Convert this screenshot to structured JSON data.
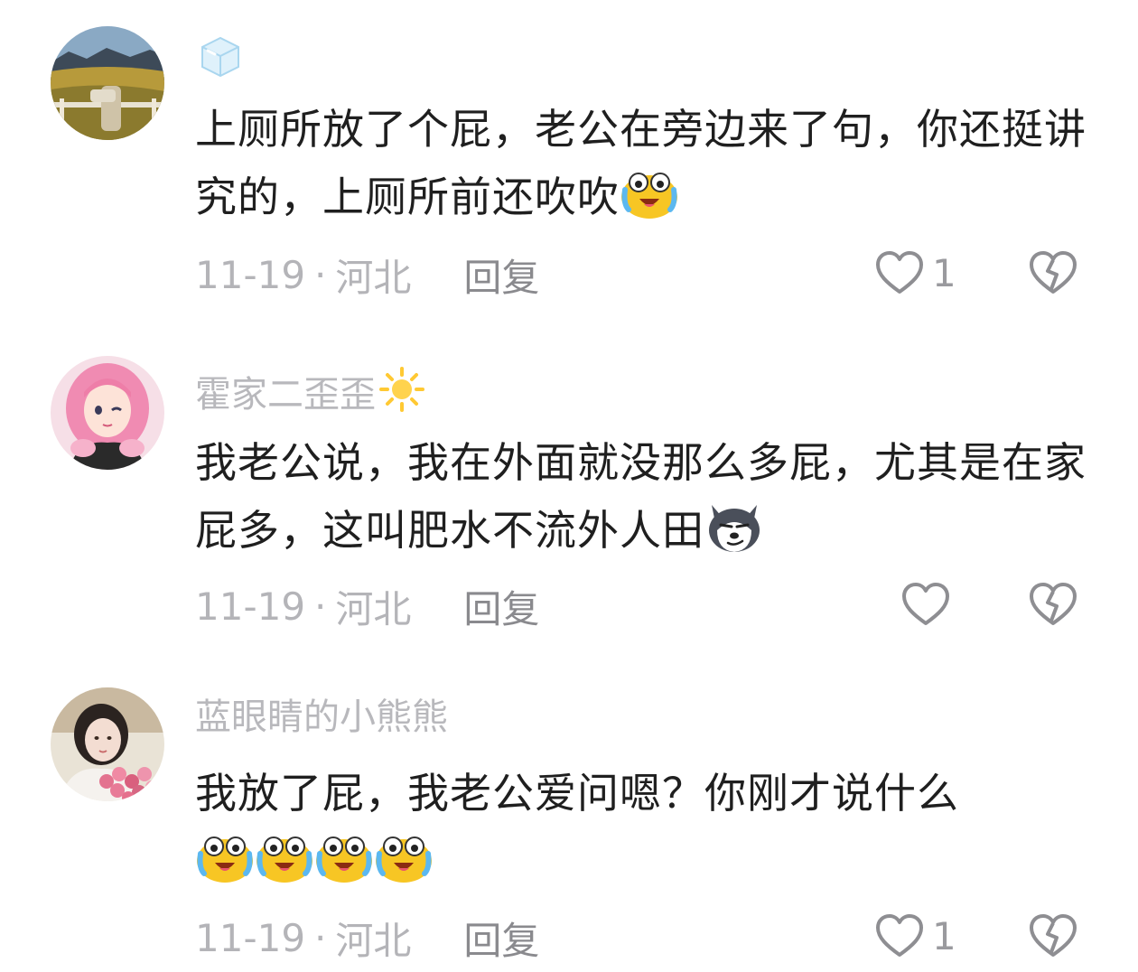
{
  "comments": [
    {
      "username": "",
      "username_icon": "ice-cube-icon",
      "text_parts": [
        "上厕所放了个屁，老公在旁边来了句，你还挺讲究的，上厕所前还吹吹"
      ],
      "trailing_emoji": [
        "cry-laugh-emoji"
      ],
      "date": "11-19",
      "separator": "·",
      "location": "河北",
      "reply_label": "回复",
      "like_count": "1"
    },
    {
      "username": "霍家二歪歪",
      "username_icon": "sun-icon",
      "text_parts": [
        "我老公说，我在外面就没那么多屁，尤其是在家屁多，这叫肥水不流外人田"
      ],
      "trailing_emoji": [
        "smirk-husky-emoji"
      ],
      "date": "11-19",
      "separator": "·",
      "location": "河北",
      "reply_label": "回复",
      "like_count": ""
    },
    {
      "username": "蓝眼睛的小熊熊",
      "username_icon": "",
      "text_parts": [
        "我放了屁，我老公爱问嗯？你刚才说什么"
      ],
      "trailing_emoji": [
        "cry-laugh-emoji",
        "cry-laugh-emoji",
        "cry-laugh-emoji",
        "cry-laugh-emoji"
      ],
      "date": "11-19",
      "separator": "·",
      "location": "河北",
      "reply_label": "回复",
      "like_count": "1"
    }
  ],
  "colors": {
    "text": "#1f1f1f",
    "meta": "#b4b4b8",
    "username": "#b8b8bc",
    "icon": "#8e8e92"
  }
}
